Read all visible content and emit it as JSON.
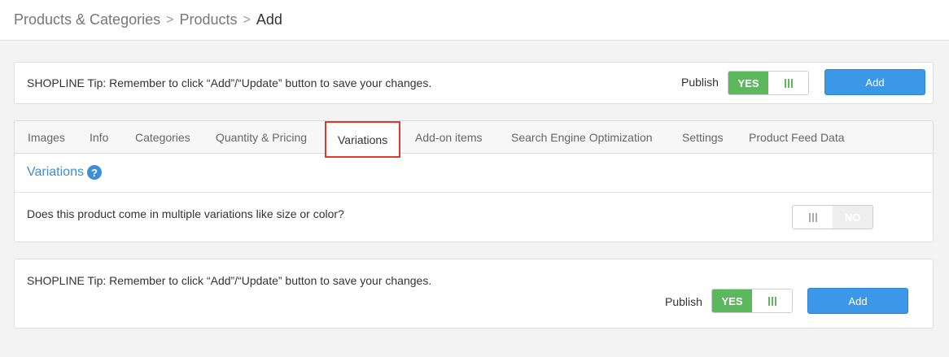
{
  "breadcrumb": {
    "items": [
      "Products & Categories",
      "Products"
    ],
    "current": "Add",
    "separator": ">"
  },
  "top_bar": {
    "tip": "SHOPLINE Tip: Remember to click “Add”/“Update” button to save your changes.",
    "publish_label": "Publish",
    "publish_toggle": {
      "value": "YES",
      "on": true
    },
    "add_button": "Add"
  },
  "tabs": [
    {
      "label": "Images",
      "active": false
    },
    {
      "label": "Info",
      "active": false
    },
    {
      "label": "Categories",
      "active": false
    },
    {
      "label": "Quantity & Pricing",
      "active": false
    },
    {
      "label": "Variations",
      "active": true
    },
    {
      "label": "Add-on items",
      "active": false
    },
    {
      "label": "Search Engine Optimization",
      "active": false
    },
    {
      "label": "Settings",
      "active": false
    },
    {
      "label": "Product Feed Data",
      "active": false
    }
  ],
  "variations": {
    "title": "Variations",
    "help_icon": "question-circle-icon",
    "question": "Does this product come in multiple variations like size or color?",
    "toggle": {
      "value": "NO",
      "on": false
    }
  },
  "bottom_bar": {
    "tip": "SHOPLINE Tip: Remember to click “Add”/“Update” button to save your changes.",
    "publish_label": "Publish",
    "publish_toggle": {
      "value": "YES",
      "on": true
    },
    "add_button": "Add"
  },
  "colors": {
    "accent_blue": "#3b98e8",
    "toggle_green": "#5cb85c",
    "highlight_red": "#e03a2c",
    "link_blue": "#3b8fd6"
  }
}
